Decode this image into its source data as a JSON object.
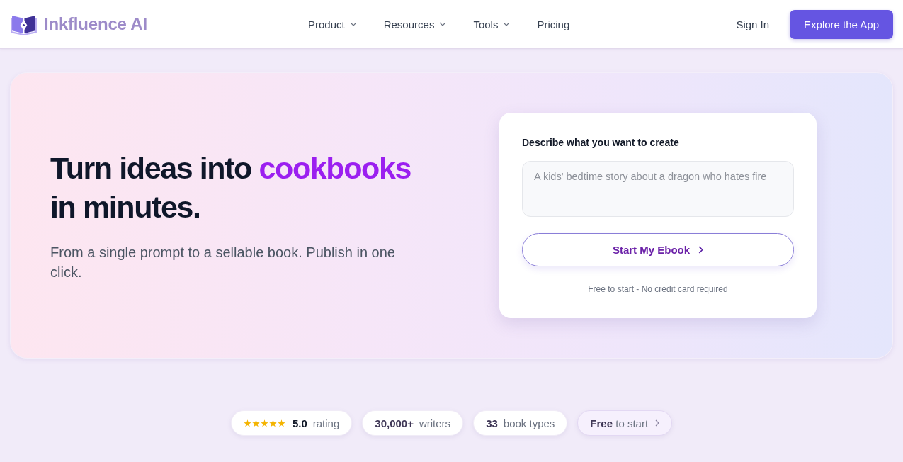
{
  "header": {
    "brand": "Inkfluence AI",
    "nav": [
      {
        "label": "Product",
        "has_menu": true
      },
      {
        "label": "Resources",
        "has_menu": true
      },
      {
        "label": "Tools",
        "has_menu": true
      },
      {
        "label": "Pricing",
        "has_menu": false
      }
    ],
    "sign_in": "Sign In",
    "cta": "Explore the App"
  },
  "hero": {
    "headline": {
      "lead": "Turn ideas into",
      "highlight": "cookbooks",
      "tail": "in minutes."
    },
    "subtitle": "From a single prompt to a sellable book. Publish in one click.",
    "form": {
      "label": "Describe what you want to create",
      "placeholder": "A kids' bedtime story about a dragon who hates fire",
      "button": "Start My Ebook",
      "note": "Free to start - No credit card required"
    }
  },
  "stats": [
    {
      "kind": "rating",
      "stars": 5,
      "value": "5.0",
      "label": "rating"
    },
    {
      "kind": "stat",
      "value": "30,000+",
      "label": "writers"
    },
    {
      "kind": "stat",
      "value": "33",
      "label": "book types"
    },
    {
      "kind": "link",
      "value": "Free",
      "label": "to start"
    }
  ]
}
